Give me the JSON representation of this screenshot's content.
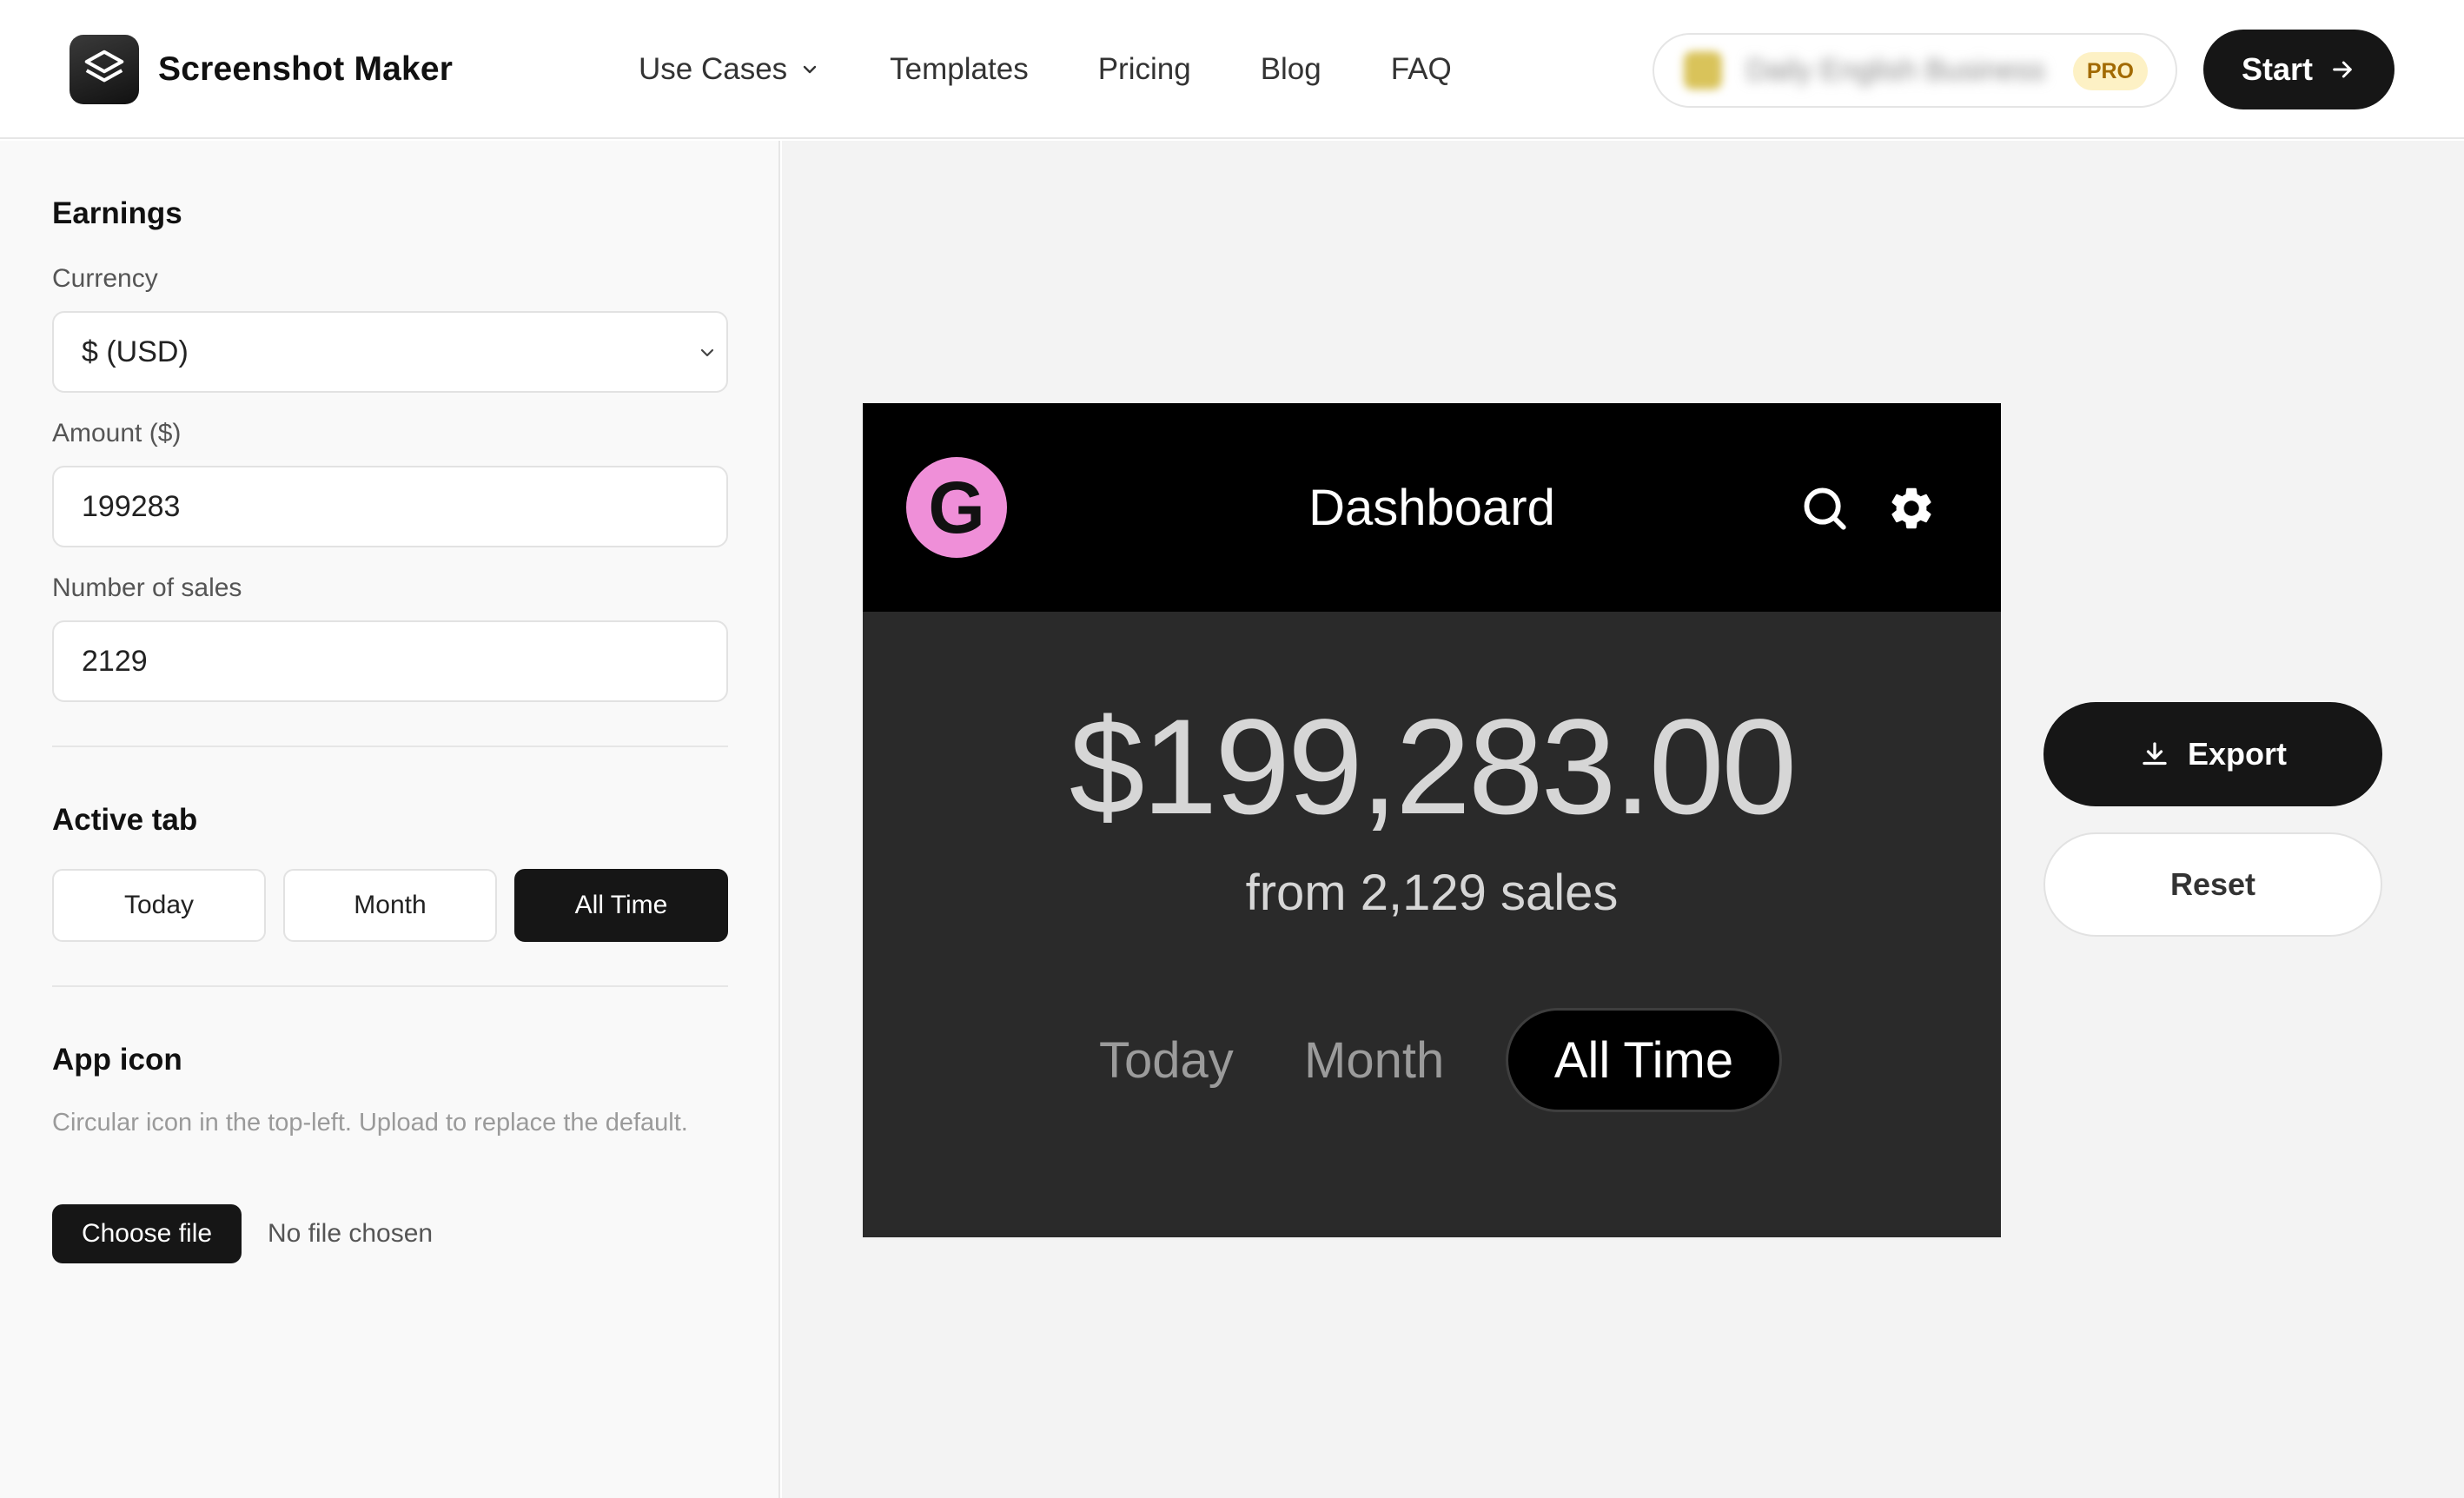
{
  "header": {
    "app_name": "Screenshot Maker",
    "nav": [
      {
        "label": "Use Cases",
        "has_dropdown": true
      },
      {
        "label": "Templates"
      },
      {
        "label": "Pricing"
      },
      {
        "label": "Blog"
      },
      {
        "label": "FAQ"
      }
    ],
    "account": {
      "name": "Daily English Business",
      "badge": "PRO"
    },
    "start_label": "Start"
  },
  "sidebar": {
    "earnings": {
      "title": "Earnings",
      "currency_label": "Currency",
      "currency_value": "$ (USD)",
      "amount_label": "Amount ($)",
      "amount_value": "199283",
      "sales_label": "Number of sales",
      "sales_value": "2129"
    },
    "active_tab": {
      "title": "Active tab",
      "options": [
        "Today",
        "Month",
        "All Time"
      ],
      "selected": "All Time"
    },
    "app_icon": {
      "title": "App icon",
      "help": "Circular icon in the top-left. Upload to replace the default.",
      "choose_label": "Choose file",
      "status": "No file chosen"
    }
  },
  "preview": {
    "logo_letter": "G",
    "title": "Dashboard",
    "amount": "$199,283.00",
    "subtitle": "from 2,129 sales",
    "tabs": [
      "Today",
      "Month",
      "All Time"
    ],
    "active_tab": "All Time",
    "colors": {
      "header_bg": "#000000",
      "body_bg": "#2a2a2a",
      "logo_bg": "#ef8fd8"
    }
  },
  "actions": {
    "export_label": "Export",
    "reset_label": "Reset"
  }
}
